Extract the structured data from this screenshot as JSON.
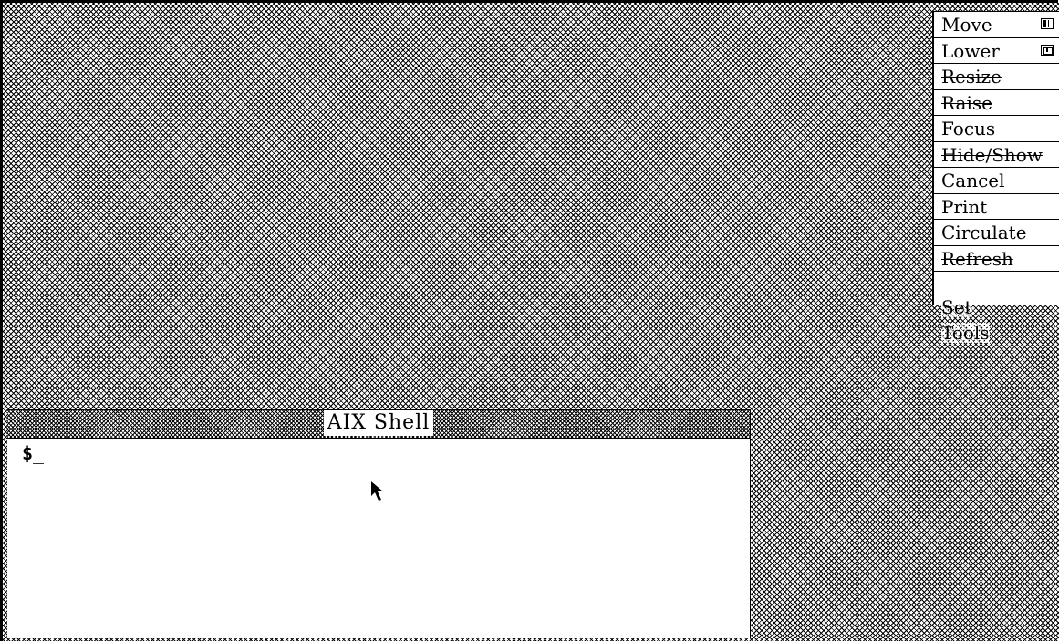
{
  "wm_menu": {
    "items": [
      {
        "label": "Move",
        "struck": false,
        "icon": "move-mini-icon"
      },
      {
        "label": "Lower",
        "struck": false,
        "icon": "lower-mini-icon"
      },
      {
        "label": "Resize",
        "struck": true
      },
      {
        "label": "Raise",
        "struck": true
      },
      {
        "label": "Focus",
        "struck": true
      },
      {
        "label": "Hide/Show",
        "struck": true
      },
      {
        "label": "Cancel",
        "struck": false
      },
      {
        "label": "Print",
        "struck": false
      },
      {
        "label": "Circulate",
        "struck": false
      },
      {
        "label": "Refresh",
        "struck": true
      }
    ]
  },
  "side_labels": {
    "set": "Set",
    "tools": "Tools"
  },
  "shell": {
    "title": "AIX Shell",
    "prompt": "$",
    "cursor": "_"
  },
  "icons": {
    "pointer": "arrow-cursor-icon"
  }
}
